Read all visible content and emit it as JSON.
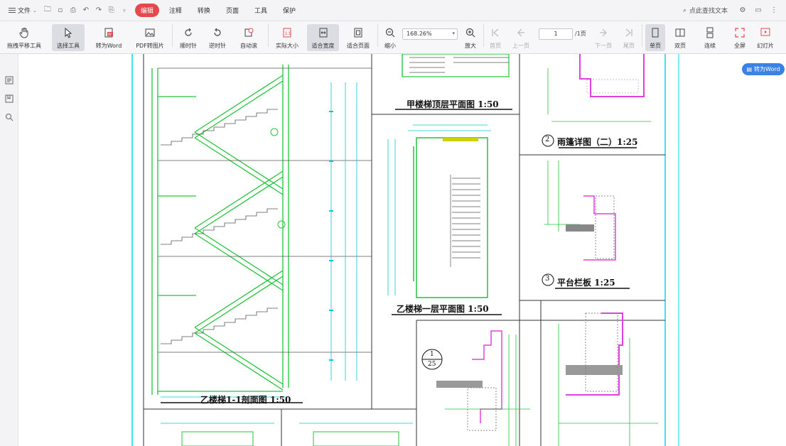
{
  "menubar": {
    "file_label": "文件",
    "tabs": [
      {
        "label": "编辑",
        "active": true
      },
      {
        "label": "注释",
        "active": false
      },
      {
        "label": "转换",
        "active": false
      },
      {
        "label": "页面",
        "active": false
      },
      {
        "label": "工具",
        "active": false
      },
      {
        "label": "保护",
        "active": false
      }
    ],
    "search_label": "点此查找文本"
  },
  "ribbon": {
    "buttons": [
      {
        "label": "拖拽平移工具",
        "icon": "hand-icon"
      },
      {
        "label": "选择工具",
        "icon": "cursor-icon",
        "active": true
      },
      {
        "label": "转为Word",
        "icon": "word-icon"
      },
      {
        "label": "PDF转图片",
        "icon": "image-icon"
      },
      {
        "label": "顺时针",
        "icon": "rotate-cw-icon"
      },
      {
        "label": "逆时针",
        "icon": "rotate-ccw-icon"
      },
      {
        "label": "自动滚",
        "icon": "auto-scroll-icon"
      },
      {
        "label": "实际大小",
        "icon": "actual-size-icon"
      },
      {
        "label": "适合宽度",
        "icon": "fit-width-icon",
        "active": true
      },
      {
        "label": "适合页面",
        "icon": "fit-page-icon"
      },
      {
        "label": "缩小",
        "icon": "zoom-out-icon"
      },
      {
        "label": "放大",
        "icon": "zoom-in-icon"
      },
      {
        "label": "首页",
        "icon": "first-page-icon",
        "dim": true
      },
      {
        "label": "上一页",
        "icon": "prev-page-icon",
        "dim": true
      },
      {
        "label": "下一页",
        "icon": "next-page-icon",
        "dim": true
      },
      {
        "label": "尾页",
        "icon": "last-page-icon",
        "dim": true
      },
      {
        "label": "单页",
        "icon": "single-page-icon",
        "active": true
      },
      {
        "label": "双页",
        "icon": "double-page-icon"
      },
      {
        "label": "连续",
        "icon": "continuous-icon"
      },
      {
        "label": "全屏",
        "icon": "fullscreen-icon"
      },
      {
        "label": "幻灯片",
        "icon": "slideshow-icon"
      }
    ],
    "zoom_value": "168.26%",
    "page_current": "1",
    "page_total": "/1页"
  },
  "floating": {
    "to_word_label": "转为Word"
  },
  "drawing": {
    "labels": {
      "left_section_title": "乙楼梯1-1剖面图  1:50",
      "top_plan_title": "甲楼梯顶层平面图  1:50",
      "mid_plan_title": "乙楼梯一层平面图  1:50",
      "detail2_title": "雨篷详图（二）1:25",
      "detail3_title": "平台栏板  1:25",
      "detail2_num": "2",
      "detail3_num": "3",
      "detail1_num": "1",
      "detail1_scale": "25"
    }
  },
  "colors": {
    "tab_active": "#e5494d",
    "accent": "#3b82e6",
    "cad_cyan": "#00d8e8",
    "cad_green": "#22c43c",
    "cad_magenta": "#e040e0",
    "cad_yellow": "#c8d400"
  }
}
